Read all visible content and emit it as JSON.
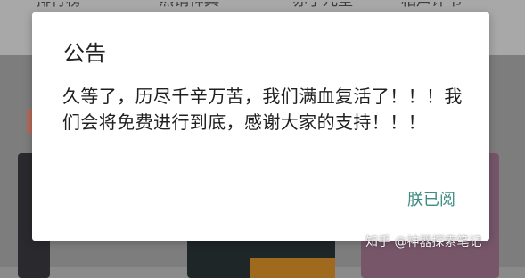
{
  "background": {
    "tabs": [
      "排行榜",
      "热销神典",
      "亦了儿童",
      "相声评书"
    ]
  },
  "dialog": {
    "title": "公告",
    "message": "久等了，历尽千辛万苦，我们满血复活了！！！我们会将免费进行到底，感谢大家的支持！！！",
    "action_label": "朕已阅"
  },
  "watermark": "知乎 @神器探索笔记",
  "colors": {
    "dialog_bg": "#ffffff",
    "action": "#3d8c82",
    "overlay": "#7d7d7d"
  }
}
